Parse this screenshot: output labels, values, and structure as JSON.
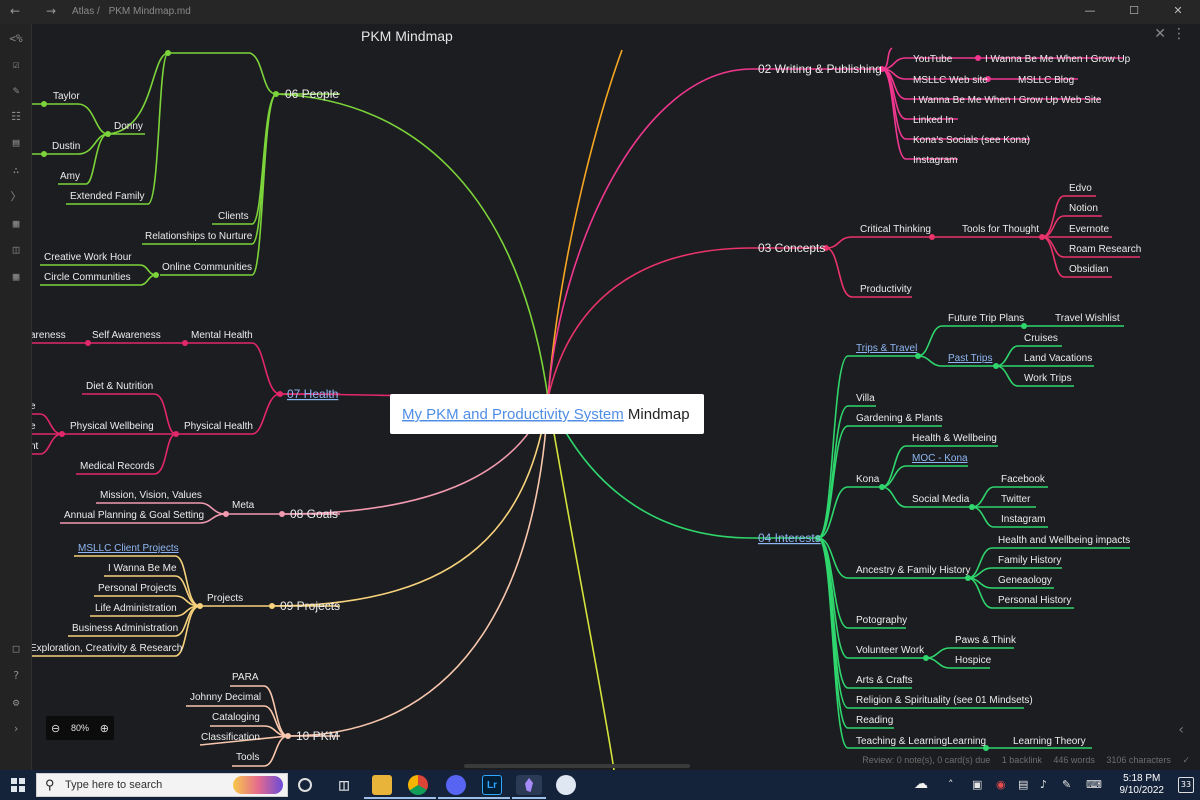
{
  "titlebar": {
    "back_icon": "arrow-left-icon",
    "forward_icon": "arrow-right-icon",
    "breadcrumb": [
      "Atlas /",
      "PKM Mindmap.md"
    ],
    "controls": [
      "minimize-icon",
      "maximize-icon",
      "close-icon"
    ]
  },
  "ribbon": {
    "top_icons": [
      "collapse-icon",
      "checkbox-icon",
      "tag-icon",
      "files-icon",
      "note-icon",
      "graph-icon",
      "terminal-icon",
      "blocks-icon",
      "panel-icon",
      "calendar-icon"
    ],
    "bottom_icons": [
      "vault-icon",
      "help-icon",
      "settings-icon",
      "expand-icon"
    ]
  },
  "view": {
    "title": "PKM Mindmap",
    "close_icon": "close-icon",
    "more_icon": "more-vertical-icon"
  },
  "mindmap": {
    "root": {
      "link": "My PKM and Productivity System",
      "suffix": " Mindmap"
    },
    "branches": {
      "people": "06 People",
      "health": "07 Health",
      "goals": "08 Goals",
      "projects": "09 Projects",
      "pkm": "10 PKM",
      "writing": "02 Writing & Publishing",
      "concepts": "03 Concepts",
      "interests": "04 Interests"
    },
    "people": {
      "donny": "Donny",
      "taylor": "Taylor",
      "dustin": "Dustin",
      "amy": "Amy",
      "extended": "Extended Family",
      "clients": "Clients",
      "relationships": "Relationships to Nurture",
      "online": "Online Communities",
      "creative": "Creative Work Hour",
      "circle": "Circle Communities"
    },
    "health": {
      "mental": "Mental Health",
      "self_awareness": "Self Awareness",
      "awareness_cut": "areness",
      "physical": "Physical Health",
      "diet": "Diet & Nutrition",
      "wellbeing": "Physical Wellbeing",
      "medical": "Medical Records",
      "cut_e1": "e",
      "cut_e2": "e",
      "cut_nt": "nt"
    },
    "goals": {
      "meta": "Meta",
      "mission": "Mission, Vision, Values",
      "annual": "Annual Planning & Goal Setting"
    },
    "projects": {
      "projects": "Projects",
      "msllc": "MSLLC Client Projects",
      "wannabe": "I Wanna Be Me",
      "personal": "Personal Projects",
      "life": "Life Administration",
      "business": "Business Administration",
      "exploration": "Exploration, Creativity & Research"
    },
    "pkm": {
      "para": "PARA",
      "johnny": "Johnny Decimal",
      "cataloging": "Cataloging",
      "classification": "Classification",
      "tools": "Tools"
    },
    "writing": {
      "youtube": "YouTube",
      "wannabe_grow": "I Wanna Be Me When I Grow Up",
      "msllc_web": "MSLLC Web site",
      "msllc_blog": "MSLLC Blog",
      "wannabe_web": "I Wanna Be Me When I Grow Up Web Site",
      "linkedin": "Linked In",
      "kona_socials": "Kona's Socials (see Kona)",
      "instagram": "Instagram"
    },
    "concepts": {
      "critical": "Critical Thinking",
      "tools": "Tools for Thought",
      "edvo": "Edvo",
      "notion": "Notion",
      "evernote": "Evernote",
      "roam": "Roam Research",
      "obsidian": "Obsidian",
      "productivity": "Productivity"
    },
    "interests": {
      "trips": "Trips & Travel",
      "future": "Future Trip Plans",
      "wishlist": "Travel Wishlist",
      "past": "Past Trips",
      "cruises": "Cruises",
      "land": "Land Vacations",
      "work_trips": "Work Trips",
      "villa": "Villa",
      "gardening": "Gardening & Plants",
      "kona": "Kona",
      "health_wb": "Health & Wellbeing",
      "moc": "MOC - Kona",
      "social": "Social Media",
      "facebook": "Facebook",
      "twitter": "Twitter",
      "instagram": "Instagram",
      "ancestry": "Ancestry & Family History",
      "health_impacts": "Health and Wellbeing impacts",
      "family_history": "Family History",
      "genealogy": "Geneaology",
      "personal_history": "Personal History",
      "photography": "Potography",
      "volunteer": "Volunteer Work",
      "paws": "Paws & Think",
      "hospice": "Hospice",
      "arts": "Arts & Crafts",
      "religion": "Religion & Spirituality (see 01 Mindsets)",
      "reading": "Reading",
      "teaching": "Teaching & LearningLearning",
      "learning_theory": "Learning Theory"
    },
    "colors": {
      "people": "#7cd43a",
      "health": "#e2276b",
      "goals": "#f29ab0",
      "projects": "#f7d27c",
      "pkm": "#f9c7ad",
      "writing": "#f0378f",
      "concepts": "#e8336b",
      "interests": "#2fd66d",
      "orange": "#f5a623",
      "yellow": "#d4e33b"
    }
  },
  "zoom": {
    "out_icon": "zoom-out-icon",
    "level": "80%",
    "in_icon": "zoom-in-icon"
  },
  "status": {
    "review": "Review: 0 note(s), 0 card(s) due",
    "backlinks": "1 backlink",
    "words": "446 words",
    "characters": "3106 characters",
    "sync_icon": "sync-check-icon"
  },
  "taskbar": {
    "start_icon": "windows-start-icon",
    "search_placeholder": "Type here to search",
    "search_icon": "search-icon",
    "apps": [
      "cortana-icon",
      "task-view-icon",
      "file-explorer-icon",
      "chrome-icon",
      "discord-icon",
      "lightroom-icon",
      "obsidian-icon",
      "paint-icon"
    ],
    "lightroom_label": "Lr",
    "clock_time": "5:18 PM",
    "clock_date": "9/10/2022",
    "notifications": "33"
  }
}
